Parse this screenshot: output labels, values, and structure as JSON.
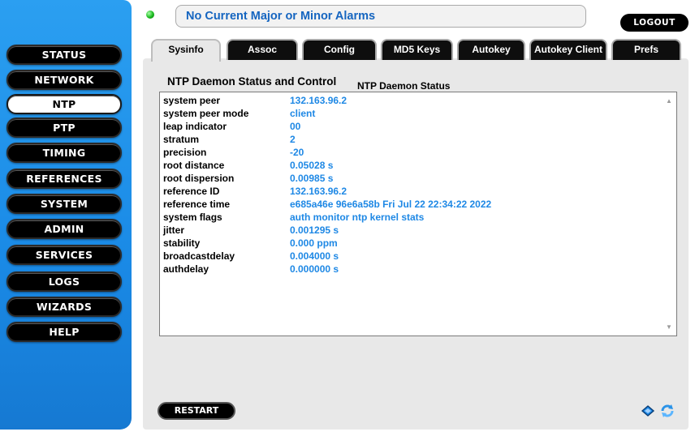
{
  "alarm": {
    "text": "No Current Major or Minor Alarms",
    "status_color": "#19b91d"
  },
  "header": {
    "logout_label": "LOGOUT"
  },
  "sidebar": {
    "items": [
      {
        "label": "STATUS"
      },
      {
        "label": "NETWORK"
      },
      {
        "label": "NTP",
        "active": true
      },
      {
        "label": "PTP"
      },
      {
        "label": "TIMING"
      },
      {
        "label": "REFERENCES"
      },
      {
        "label": "SYSTEM"
      },
      {
        "label": "ADMIN"
      },
      {
        "label": "SERVICES"
      },
      {
        "label": "LOGS"
      },
      {
        "label": "WIZARDS"
      },
      {
        "label": "HELP"
      }
    ]
  },
  "tabs": [
    {
      "label": "Sysinfo",
      "active": true
    },
    {
      "label": "Assoc"
    },
    {
      "label": "Config"
    },
    {
      "label": "MD5 Keys"
    },
    {
      "label": "Autokey"
    },
    {
      "label": "Autokey Client"
    },
    {
      "label": "Prefs"
    }
  ],
  "main": {
    "title": "NTP Daemon Status and Control",
    "subtitle": "NTP Daemon Status",
    "rows": [
      {
        "key": "system peer",
        "value": "132.163.96.2"
      },
      {
        "key": "system peer mode",
        "value": "client"
      },
      {
        "key": "leap indicator",
        "value": "00"
      },
      {
        "key": "stratum",
        "value": "2"
      },
      {
        "key": "precision",
        "value": "-20"
      },
      {
        "key": "root distance",
        "value": "0.05028 s"
      },
      {
        "key": "root dispersion",
        "value": "0.00985 s"
      },
      {
        "key": "reference ID",
        "value": "132.163.96.2"
      },
      {
        "key": "reference time",
        "value": "e685a46e 96e6a58b Fri Jul 22 22:34:22 2022"
      },
      {
        "key": "system flags",
        "value": "auth monitor ntp kernel stats"
      },
      {
        "key": "jitter",
        "value": "0.001295 s"
      },
      {
        "key": "stability",
        "value": "0.000 ppm"
      },
      {
        "key": "broadcastdelay",
        "value": "0.004000 s"
      },
      {
        "key": "authdelay",
        "value": "0.000000 s"
      }
    ],
    "restart_label": "RESTART"
  },
  "colors": {
    "sidebar_blue": "#1a8ae6",
    "value_blue": "#1e88e5",
    "alarm_text": "#1565c0"
  },
  "icons": {
    "help": "book-icon",
    "refresh": "refresh-icon",
    "status": "led-icon"
  }
}
